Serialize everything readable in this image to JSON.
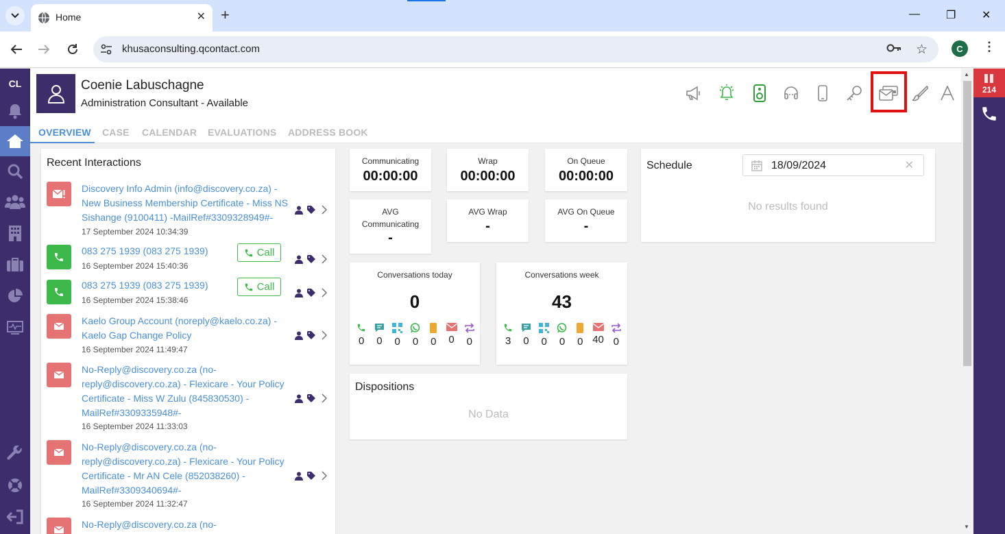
{
  "browser": {
    "tab_title": "Home",
    "url": "khusaconsulting.qcontact.com",
    "profile_initial": "C"
  },
  "leftnav": {
    "initials": "CL",
    "icons": [
      "bell-icon",
      "home-icon",
      "search-icon",
      "people-icon",
      "building-icon",
      "briefcase-icon",
      "pie-chart-icon",
      "monitor-icon",
      "wrench-icon",
      "lifebuoy-icon",
      "logout-icon"
    ]
  },
  "right_rail": {
    "badge_count": "214"
  },
  "header": {
    "agent_name": "Coenie Labuschagne",
    "agent_role": "Administration Consultant - Available",
    "icons": [
      "megaphone-icon",
      "bell-icon",
      "speaker-icon",
      "headset-icon",
      "mobile-icon",
      "key-icon",
      "envelope-card-icon",
      "brush-icon",
      "font-icon"
    ],
    "accent": "#3d2e6b",
    "highlight_color": "#e01010"
  },
  "tabs": [
    "OVERVIEW",
    "CASE",
    "CALENDAR",
    "EVALUATIONS",
    "ADDRESS BOOK"
  ],
  "recent_interactions": {
    "title": "Recent Interactions",
    "call_label": "Call",
    "items": [
      {
        "type": "email-alert",
        "text": "Discovery Info Admin (info@discovery.co.za) - New Business Membership Certificate - Miss NS Sishange (9100411) -MailRef#3309328949#-",
        "date": "17 September 2024 10:34:39"
      },
      {
        "type": "call",
        "text": "083 275 1939 (083 275 1939)",
        "date": "16 September 2024 15:40:36"
      },
      {
        "type": "call",
        "text": "083 275 1939 (083 275 1939)",
        "date": "16 September 2024 15:38:46"
      },
      {
        "type": "email",
        "text": "Kaelo Group Account (noreply@kaelo.co.za) - Kaelo Gap Change Policy",
        "date": "16 September 2024 11:49:47"
      },
      {
        "type": "email",
        "text": "No-Reply@discovery.co.za (no-reply@discovery.co.za) - Flexicare - Your Policy Certificate - Miss W Zulu (845830530) - MailRef#3309335948#-",
        "date": "16 September 2024 11:33:03"
      },
      {
        "type": "email",
        "text": "No-Reply@discovery.co.za (no-reply@discovery.co.za) - Flexicare - Your Policy Certificate - Mr AN Cele (852038260) - MailRef#3309340694#-",
        "date": "16 September 2024 11:32:47"
      },
      {
        "type": "email",
        "text": "No-Reply@discovery.co.za (no-",
        "date": ""
      }
    ]
  },
  "stats": [
    {
      "label": "Communicating",
      "value": "00:00:00"
    },
    {
      "label": "Wrap",
      "value": "00:00:00"
    },
    {
      "label": "On Queue",
      "value": "00:00:00"
    },
    {
      "label": "AVG Communicating",
      "value": "-"
    },
    {
      "label": "AVG Wrap",
      "value": "-"
    },
    {
      "label": "AVG On Queue",
      "value": "-"
    }
  ],
  "conversations": [
    {
      "label": "Conversations today",
      "total": "0",
      "channels": [
        "0",
        "0",
        "0",
        "0",
        "0",
        "0",
        "0"
      ]
    },
    {
      "label": "Conversations week",
      "total": "43",
      "channels": [
        "3",
        "0",
        "0",
        "0",
        "0",
        "40",
        "0"
      ]
    }
  ],
  "channel_icons": [
    "phone-icon",
    "chat-icon",
    "qr-icon",
    "whatsapp-icon",
    "sms-icon",
    "email-icon",
    "transfer-icon"
  ],
  "channel_colors": [
    "#3cb94a",
    "#3aa0a0",
    "#3fb6d6",
    "#3cb94a",
    "#f0a830",
    "#e57373",
    "#9b59d0"
  ],
  "schedule": {
    "title": "Schedule",
    "date": "18/09/2024",
    "empty": "No results found"
  },
  "dispositions": {
    "title": "Dispositions",
    "empty": "No Data"
  }
}
